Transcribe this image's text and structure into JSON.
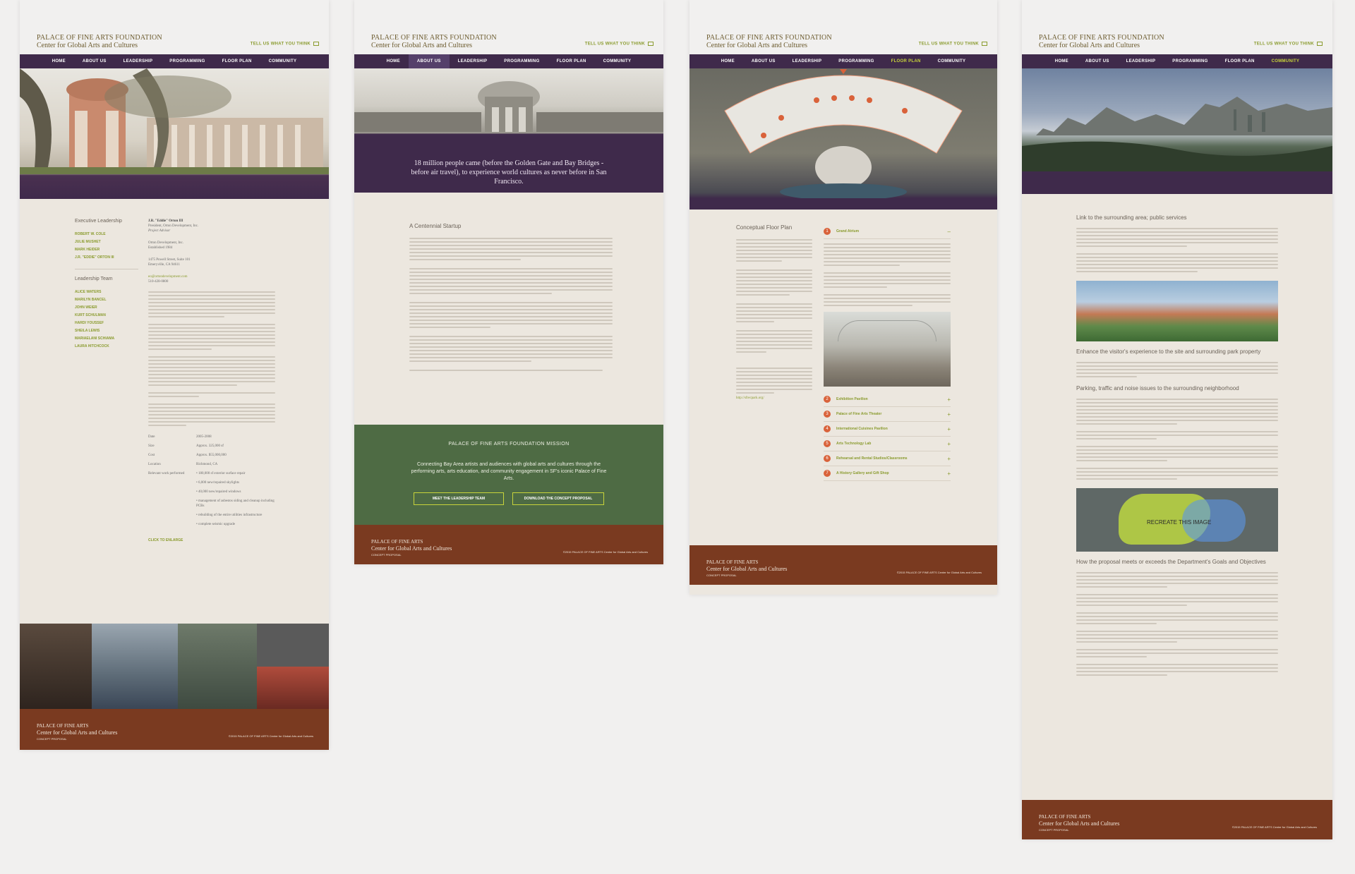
{
  "brand": {
    "title": "PALACE OF FINE ARTS FOUNDATION",
    "subtitle": "Center for Global Arts and Cultures",
    "tell": "TELL US WHAT YOU THINK"
  },
  "nav": [
    "HOME",
    "ABOUT US",
    "LEADERSHIP",
    "PROGRAMMING",
    "FLOOR PLAN",
    "COMMUNITY"
  ],
  "footer": {
    "line1": "PALACE OF FINE ARTS",
    "line2": "Center for Global Arts and Cultures",
    "line3": "CONCEPT PROPOSAL",
    "copyright": "©2015 PALACE OF FINE ARTS Center for Global Arts and Cultures"
  },
  "leadership": {
    "exec_title": "Executive Leadership",
    "exec": [
      "ROBERT W. COLE",
      "JULIE MUSHET",
      "MARK HEIDER",
      "J.R. \"EDDIE\" ORTON III"
    ],
    "team_title": "Leadership Team",
    "team": [
      "ALICE WATERS",
      "MARILYN BANCEL",
      "JOHN WEIER",
      "KURT SCHULMAN",
      "HARDI YOUSSEF",
      "SHEILA LEWIS",
      "MARIAELANI SCHIAMA",
      "LAURA HITCHCOCK"
    ],
    "person_name": "J.R. \"Eddie\" Orton III",
    "person_role": "President, Orton Development, Inc.",
    "person_sub": "Project Advisor",
    "company": "Orton Development, Inc.",
    "established": "Established 1984",
    "address1": "1475 Powell Street, Suite 101",
    "address2": "Emeryville, CA 94611",
    "email": "eo@ortondevelopment.com",
    "phone": "510-428-0800",
    "facts": [
      {
        "k": "Date",
        "v": "2005-2008"
      },
      {
        "k": "Size",
        "v": "Approx. 325,000 sf"
      },
      {
        "k": "Cost",
        "v": "Approx. $55,000,000"
      },
      {
        "k": "Location",
        "v": "Richmond, CA"
      },
      {
        "k": "Relevant work performed",
        "v": "• 180,000 sf exterior surface repair"
      }
    ],
    "bullets": [
      "• 6,000 new/repaired skylights",
      "• 40,000 new/repaired windows",
      "• management of asbestos siding and cleanup including PCBs",
      "• rebuilding of the entire utilities infrastructure",
      "• complete seismic upgrade"
    ],
    "enlarge": "CLICK TO ENLARGE"
  },
  "about": {
    "quote": "18 million people came (before the Golden Gate and Bay Bridges - before air travel), to experience world cultures as never before in San Francisco.",
    "section": "A Centennial Startup",
    "mission_title": "PALACE OF FINE ARTS FOUNDATION MISSION",
    "mission_text": "Connecting Bay Area artists and audiences with global arts and cultures through the performing arts, arts education, and community engagement in SF's iconic Palace of Fine Arts.",
    "btn1": "MEET THE LEADERSHIP TEAM",
    "btn2": "DOWNLOAD THE CONCEPT PROPOSAL"
  },
  "floor": {
    "title": "Conceptual Floor Plan",
    "items": [
      {
        "n": "1",
        "label": "Grand Atrium",
        "sign": "–"
      },
      {
        "n": "2",
        "label": "Exhibition Pavilion",
        "sign": "+"
      },
      {
        "n": "3",
        "label": "Palace of Fine Arts Theater",
        "sign": "+"
      },
      {
        "n": "4",
        "label": "International Cuisines Pavilion",
        "sign": "+"
      },
      {
        "n": "5",
        "label": "Arts Technology Lab",
        "sign": "+"
      },
      {
        "n": "6",
        "label": "Rehearsal and Rental Studios/Classrooms",
        "sign": "+"
      },
      {
        "n": "7",
        "label": "A History Gallery and Gift Shop",
        "sign": "+"
      }
    ],
    "link": "http://sfrecpark.org/"
  },
  "community": {
    "h1": "Link to the surrounding area; public services",
    "h2": "Enhance the visitor's experience to the site and surrounding park property",
    "h3": "Parking, traffic and noise issues to the surrounding neighborhood",
    "map_label": "RECREATE THIS IMAGE",
    "h4": "How the proposal meets or exceeds the Department's Goals and Objectives"
  },
  "colors": {
    "purple": "#3f2a4b",
    "olive": "#8a9b2e",
    "rust": "#7a3a20",
    "green": "#4e6b44",
    "cream": "#ece7df"
  }
}
